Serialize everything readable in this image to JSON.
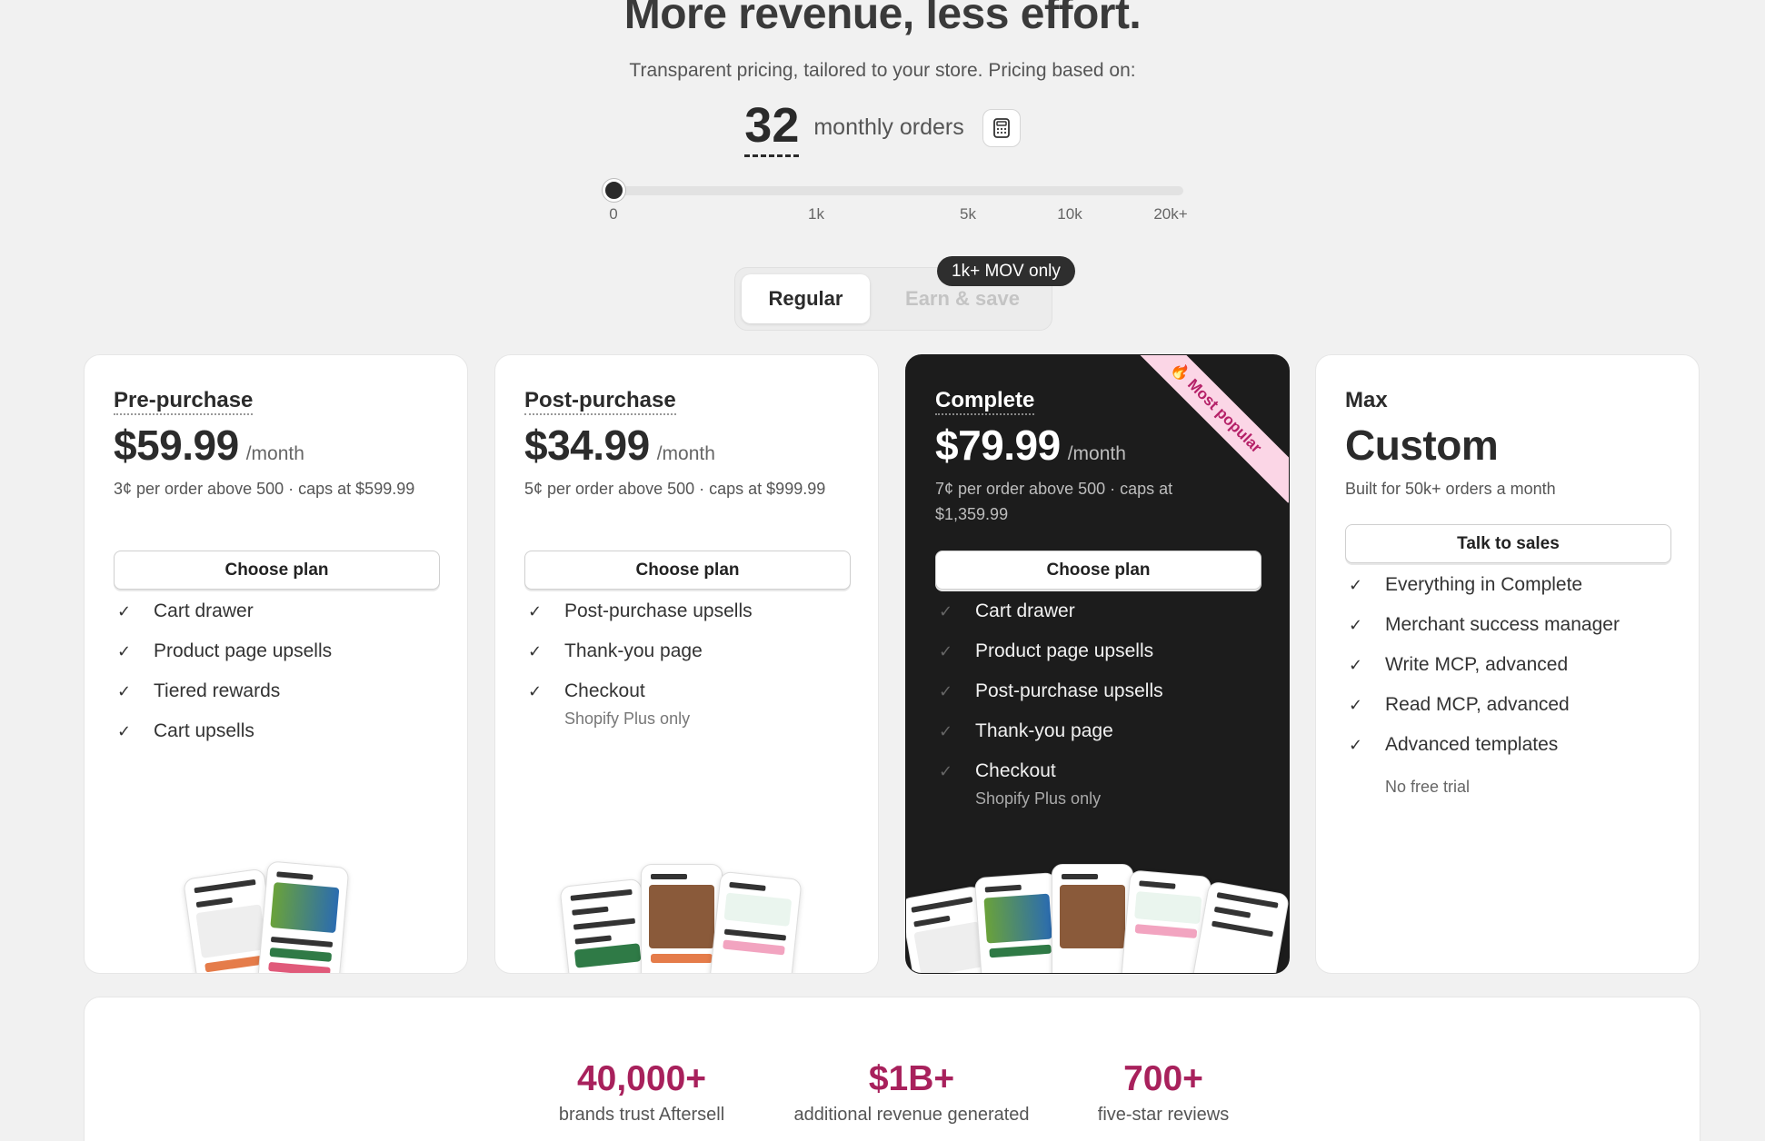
{
  "hero": {
    "title": "More revenue, less effort.",
    "subtitle": "Transparent pricing, tailored to your store. Pricing based on:"
  },
  "orders": {
    "count": "32",
    "label": "monthly orders",
    "calculator_icon": "calculator-icon",
    "slider_ticks": [
      "0",
      "1k",
      "5k",
      "10k",
      "20k+"
    ],
    "slider_value": 32
  },
  "billing_toggle": {
    "regular": "Regular",
    "earn_save": "Earn & save",
    "badge": "1k+ MOV only",
    "selected": "Regular"
  },
  "plans": [
    {
      "name": "Pre-purchase",
      "price": "$59.99",
      "per": "/month",
      "note": "3¢ per order above 500 · caps at $599.99",
      "button": "Choose plan",
      "features": [
        {
          "text": "Cart drawer",
          "sub": ""
        },
        {
          "text": "Product page upsells",
          "sub": ""
        },
        {
          "text": "Tiered rewards",
          "sub": ""
        },
        {
          "text": "Cart upsells",
          "sub": ""
        }
      ]
    },
    {
      "name": "Post-purchase",
      "price": "$34.99",
      "per": "/month",
      "note": "5¢ per order above 500 · caps at $999.99",
      "button": "Choose plan",
      "features": [
        {
          "text": "Post-purchase upsells",
          "sub": ""
        },
        {
          "text": "Thank-you page",
          "sub": ""
        },
        {
          "text": "Checkout",
          "sub": "Shopify Plus only"
        }
      ]
    },
    {
      "name": "Complete",
      "price": "$79.99",
      "per": "/month",
      "note": "7¢ per order above 500 · caps at $1,359.99",
      "button": "Choose plan",
      "ribbon": "🔥 Most popular",
      "features": [
        {
          "text": "Cart drawer",
          "sub": ""
        },
        {
          "text": "Product page upsells",
          "sub": ""
        },
        {
          "text": "Post-purchase upsells",
          "sub": ""
        },
        {
          "text": "Thank-you page",
          "sub": ""
        },
        {
          "text": "Checkout",
          "sub": "Shopify Plus only"
        }
      ]
    },
    {
      "name": "Max",
      "price": "Custom",
      "note": "Built for 50k+ orders a month",
      "button": "Talk to sales",
      "features": [
        {
          "text": "Everything in Complete",
          "sub": ""
        },
        {
          "text": "Merchant success manager",
          "sub": ""
        },
        {
          "text": "Write MCP, advanced",
          "sub": ""
        },
        {
          "text": "Read MCP, advanced",
          "sub": ""
        },
        {
          "text": "Advanced templates",
          "sub": ""
        }
      ],
      "extra_note": "No free trial"
    }
  ],
  "stats": [
    {
      "value": "40,000+",
      "label": "brands trust Aftersell"
    },
    {
      "value": "$1B+",
      "label": "additional revenue generated"
    },
    {
      "value": "700+",
      "label": "five-star reviews"
    }
  ],
  "colors": {
    "accent": "#a8215c",
    "dark_card": "#1c1c1c",
    "ribbon_bg": "#fbd6e6",
    "ribbon_text": "#b52168"
  }
}
